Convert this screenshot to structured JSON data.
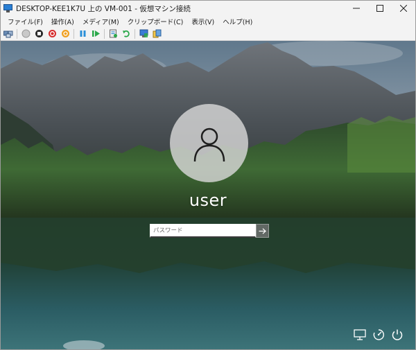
{
  "window": {
    "title": "DESKTOP-KEE1K7U 上の VM-001 - 仮想マシン接続"
  },
  "menu": {
    "items": [
      {
        "label": "ファイル(F)"
      },
      {
        "label": "操作(A)"
      },
      {
        "label": "メディア(M)"
      },
      {
        "label": "クリップボード(C)"
      },
      {
        "label": "表示(V)"
      },
      {
        "label": "ヘルプ(H)"
      }
    ]
  },
  "toolbar": {
    "icons": [
      "ctrl-alt-del-icon",
      "start-icon",
      "turn-off-icon",
      "shut-down-icon",
      "save-icon",
      "pause-icon",
      "resume-icon",
      "checkpoint-icon",
      "revert-icon",
      "enhanced-session-icon",
      "share-icon"
    ]
  },
  "lock_screen": {
    "username": "user",
    "password_placeholder": "パスワード"
  },
  "corner_icons": [
    "network-icon",
    "accessibility-icon",
    "power-icon"
  ],
  "colors": {
    "titlebar_bg": "#f3f3f3",
    "text": "#ffffff",
    "avatar_bg": "#d7d7d7"
  }
}
